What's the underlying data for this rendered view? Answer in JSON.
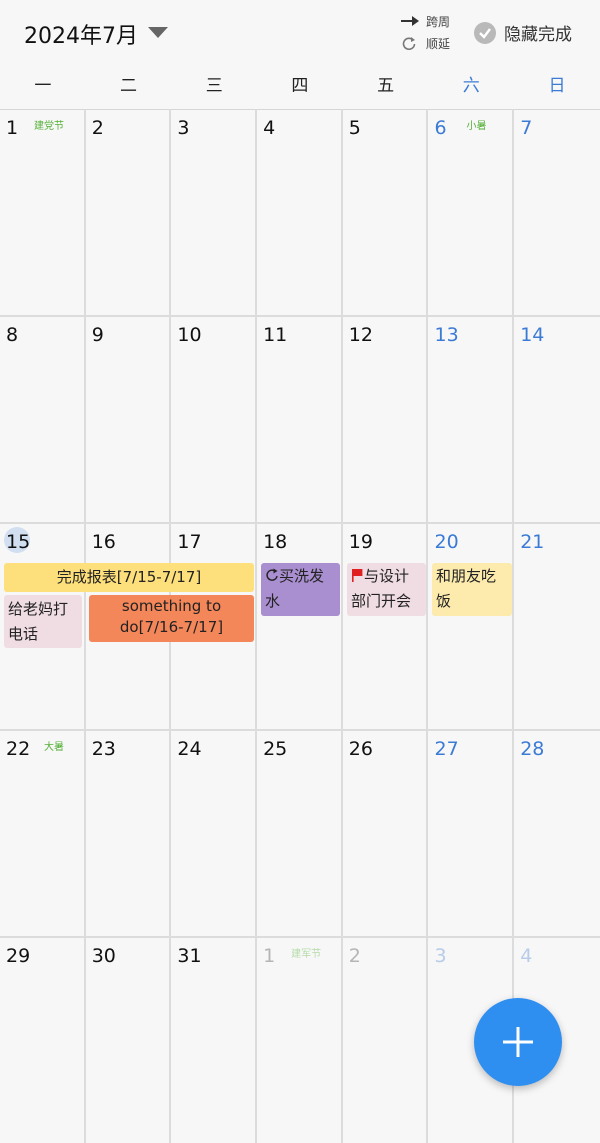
{
  "header": {
    "month_title": "2024年7月",
    "toggle_cross_week": "跨周",
    "toggle_postpone": "顺延",
    "hide_completed": "隐藏完成"
  },
  "weekdays": [
    "一",
    "二",
    "三",
    "四",
    "五",
    "六",
    "日"
  ],
  "weeks": [
    {
      "days": [
        {
          "num": "1",
          "holiday": "建党节"
        },
        {
          "num": "2"
        },
        {
          "num": "3"
        },
        {
          "num": "4"
        },
        {
          "num": "5"
        },
        {
          "num": "6",
          "holiday": "小暑"
        },
        {
          "num": "7"
        }
      ]
    },
    {
      "days": [
        {
          "num": "8"
        },
        {
          "num": "9"
        },
        {
          "num": "10"
        },
        {
          "num": "11"
        },
        {
          "num": "12"
        },
        {
          "num": "13"
        },
        {
          "num": "14"
        }
      ]
    },
    {
      "days": [
        {
          "num": "15",
          "today": true
        },
        {
          "num": "16"
        },
        {
          "num": "17"
        },
        {
          "num": "18"
        },
        {
          "num": "19"
        },
        {
          "num": "20"
        },
        {
          "num": "21"
        }
      ],
      "events": {
        "report": "完成报表[7/15-7/17]",
        "call_mom": "给老妈打电话",
        "something": "something to do[7/16-7/17]",
        "shampoo": "买洗发水",
        "meeting": "与设计部门开会",
        "dinner": "和朋友吃饭"
      }
    },
    {
      "days": [
        {
          "num": "22",
          "holiday": "大暑"
        },
        {
          "num": "23"
        },
        {
          "num": "24"
        },
        {
          "num": "25"
        },
        {
          "num": "26"
        },
        {
          "num": "27"
        },
        {
          "num": "28"
        }
      ]
    },
    {
      "days": [
        {
          "num": "29"
        },
        {
          "num": "30"
        },
        {
          "num": "31"
        },
        {
          "num": "1",
          "holiday": "建军节",
          "other": true
        },
        {
          "num": "2",
          "other": true
        },
        {
          "num": "3",
          "other": true
        },
        {
          "num": "4",
          "other": true
        }
      ]
    }
  ],
  "colors": {
    "accent": "#2f8ff1",
    "weekend": "#3b7bd6",
    "holiday": "#55b038",
    "event_yellow": "#fde07b",
    "event_pink": "#f0dde3",
    "event_orange": "#f4875a",
    "event_purple": "#a98ed0",
    "event_lightyellow": "#fdebad"
  }
}
